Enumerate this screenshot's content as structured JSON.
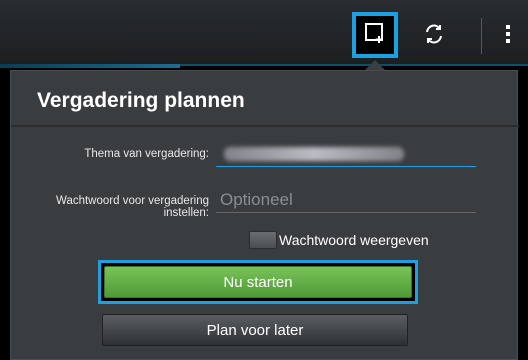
{
  "action_bar": {
    "icons": [
      "new-meeting-icon",
      "sync-icon",
      "overflow-menu-icon"
    ],
    "accent_color": "#1ba1e2"
  },
  "dialog": {
    "title": "Vergadering plannen",
    "topic_label": "Thema van vergadering:",
    "password_label": "Wachtwoord voor vergadering instellen:",
    "password_placeholder": "Optioneel",
    "show_password_label": "Wachtwoord weergeven",
    "start_button": "Nu starten",
    "later_button": "Plan voor later"
  },
  "colors": {
    "start_button": "#5fac43",
    "highlight": "#1ba1e2"
  }
}
